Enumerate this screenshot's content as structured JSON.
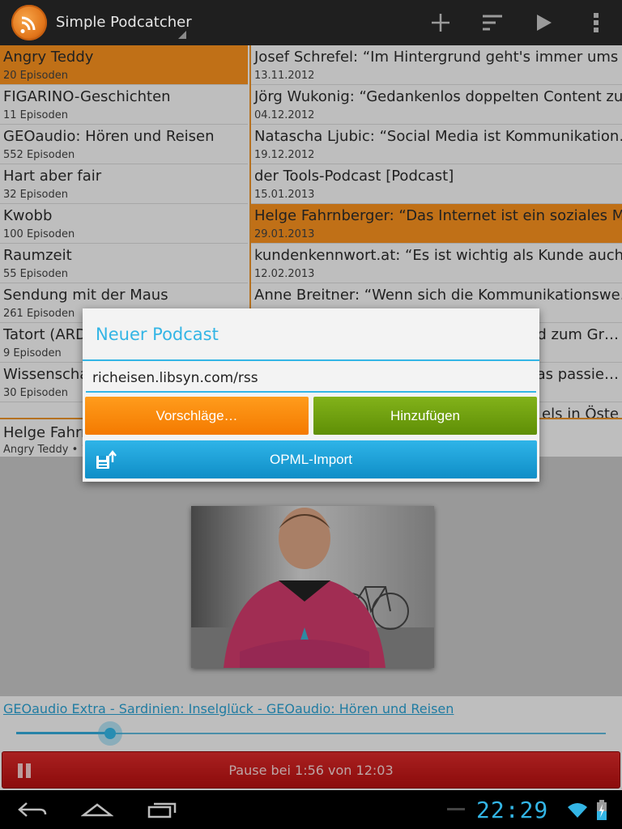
{
  "app": {
    "title": "Simple Podcatcher",
    "actions": [
      "add-icon",
      "sort-icon",
      "play-icon",
      "overflow-menu-icon"
    ]
  },
  "podcasts": [
    {
      "name": "Angry Teddy",
      "count": "20 Episoden",
      "selected": true
    },
    {
      "name": "FIGARINO-Geschichten",
      "count": "11 Episoden"
    },
    {
      "name": "GEOaudio: Hören und Reisen",
      "count": "552 Episoden"
    },
    {
      "name": "Hart aber fair",
      "count": "32 Episoden"
    },
    {
      "name": "Kwobb",
      "count": "100 Episoden"
    },
    {
      "name": "Raumzeit",
      "count": "55 Episoden"
    },
    {
      "name": "Sendung mit der Maus",
      "count": "261 Episoden"
    },
    {
      "name": "Tatort (ARD",
      "count": "9 Episoden"
    },
    {
      "name": "Wissenscha",
      "count": "30 Episoden"
    }
  ],
  "episodes": [
    {
      "title": "Josef Schrefel: “Im Hintergrund geht's immer ums",
      "date": "13.11.2012"
    },
    {
      "title": "Jörg Wukonig: “Gedankenlos doppelten Content zu…",
      "date": "04.12.2012"
    },
    {
      "title": "Natascha Ljubic: “Social Media ist Kommunikation…",
      "date": "19.12.2012"
    },
    {
      "title": "der Tools-Podcast [Podcast]",
      "date": "15.01.2013"
    },
    {
      "title": "Helge Fahrnberger: “Das Internet ist ein soziales M…",
      "date": "29.01.2013",
      "selected": true
    },
    {
      "title": "kundenkennwort.at: “Es ist wichtig als Kunde auch…",
      "date": "12.02.2013"
    },
    {
      "title": "Anne Breitner: “Wenn sich die Kommunikationswe…",
      "date": ""
    },
    {
      "title": "nd zum Gr…",
      "date": ""
    },
    {
      "title": "as passie…",
      "date": ""
    },
    {
      "title": "els in Öste",
      "date": ""
    }
  ],
  "now_playing": {
    "title": "Helge Fahrr",
    "subtitle": "Angry Teddy • 1"
  },
  "player": {
    "episode_link": "GEOaudio Extra - Sardinien: Inselglück - GEOaudio: Hören und Reisen",
    "position": "1:56",
    "duration": "12:03",
    "progress_fraction": 0.16,
    "status": "Pause bei 1:56 von 12:03"
  },
  "dialog": {
    "title": "Neuer Podcast",
    "url_value": "richeisen.libsyn.com/rss",
    "suggest_label": "Vorschläge…",
    "add_label": "Hinzufügen",
    "opml_label": "OPML-Import"
  },
  "system": {
    "clock": "22:29"
  },
  "colors": {
    "accent": "#33b5e5",
    "selection": "#f7901e",
    "suggest": "#f47a00",
    "add": "#6a9b0c",
    "opml": "#1ba2da",
    "pause": "#c41a1a"
  }
}
